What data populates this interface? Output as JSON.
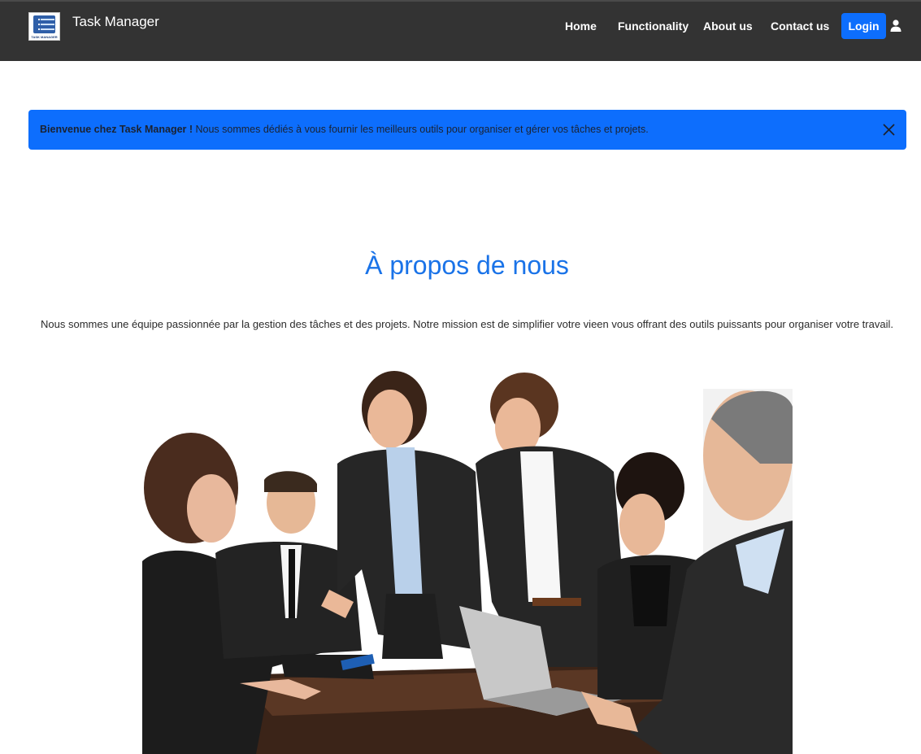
{
  "navbar": {
    "logo_caption": "TASK MANAGER",
    "brand_name": "Task Manager",
    "links": [
      "Home",
      "Functionality",
      "About us",
      "Contact us"
    ],
    "login_label": "Login"
  },
  "alert": {
    "strong_text": "Bienvenue chez Task Manager !",
    "message": " Nous sommes dédiés à vous fournir les meilleurs outils pour organiser et gérer vos tâches et projets."
  },
  "about": {
    "title": "À propos de nous",
    "text": "Nous sommes une équipe passionnée par la gestion des tâches et des projets. Notre mission est de simplifier votre vieen vous offrant des outils puissants pour organiser votre travail."
  },
  "colors": {
    "navbar_bg": "#333333",
    "primary": "#0d6efd",
    "title_blue": "#1a73e8"
  },
  "icons": {
    "user": "user-icon",
    "close": "close-icon"
  }
}
